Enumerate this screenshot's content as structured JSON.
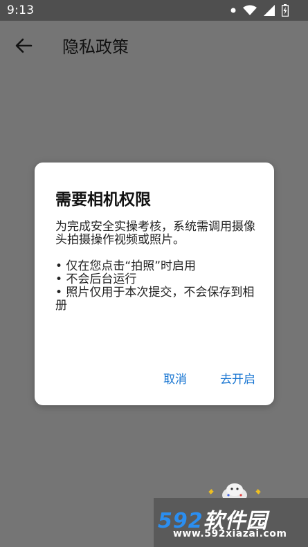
{
  "status_bar": {
    "time": "9:13",
    "icons": [
      "notification-dot-icon",
      "wifi-icon",
      "signal-icon",
      "battery-icon"
    ]
  },
  "app_bar": {
    "back_icon": "arrow-left-icon",
    "title": "隐私政策"
  },
  "dialog": {
    "title": "需要相机权限",
    "intro": "为完成安全实操考核，系统需调用摄像头拍摄操作视频或照片。",
    "bullets": [
      "• 仅在您点击“拍照”时启用",
      "• 不会后台运行",
      "• 照片仅用于本次提交，不会保存到相册"
    ],
    "cancel_label": "取消",
    "confirm_label": "去开启"
  },
  "watermark": {
    "brand_number": "592",
    "brand_text": "软件园",
    "url": "www.592xiazai.com"
  },
  "colors": {
    "background_dim": "#757575",
    "status_bar": "#4f4f4f",
    "accent": "#1976d2",
    "dialog_bg": "#ffffff",
    "watermark_blue": "#2b8ef0"
  }
}
